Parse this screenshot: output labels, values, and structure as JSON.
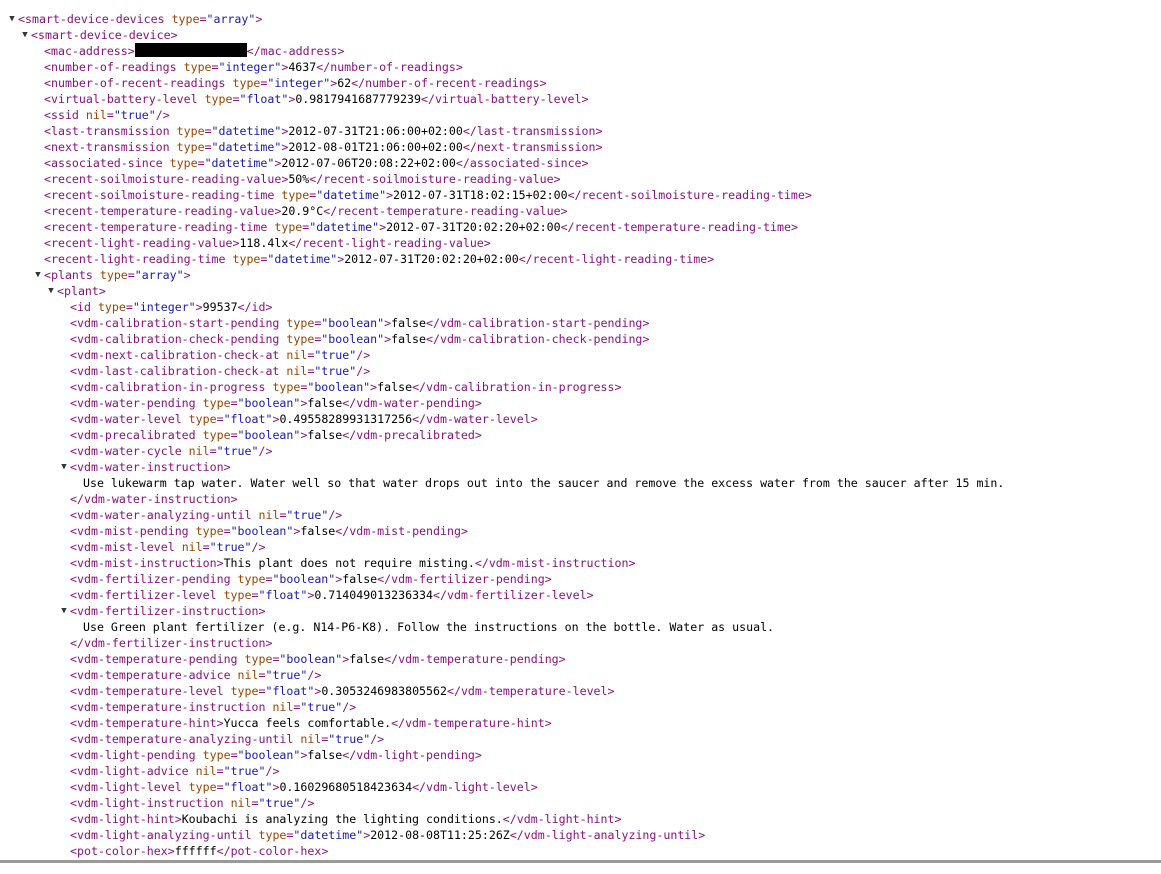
{
  "theme": {
    "tag": "#881280",
    "attr_name": "#994500",
    "attr_value": "#1a1aa6",
    "text": "#000000"
  },
  "lines": [
    {
      "d": 0,
      "t": "open",
      "tw": true,
      "tag": "smart-device-devices",
      "attrs": [
        {
          "n": "type",
          "v": "\"array\""
        }
      ]
    },
    {
      "d": 1,
      "t": "open",
      "tw": true,
      "tag": "smart-device-device",
      "attrs": []
    },
    {
      "d": 2,
      "t": "elem",
      "tag": "mac-address",
      "attrs": [],
      "text": "",
      "redacted": true
    },
    {
      "d": 2,
      "t": "elem",
      "tag": "number-of-readings",
      "attrs": [
        {
          "n": "type",
          "v": "\"integer\""
        }
      ],
      "text": "4637"
    },
    {
      "d": 2,
      "t": "elem",
      "tag": "number-of-recent-readings",
      "attrs": [
        {
          "n": "type",
          "v": "\"integer\""
        }
      ],
      "text": "62"
    },
    {
      "d": 2,
      "t": "elem",
      "tag": "virtual-battery-level",
      "attrs": [
        {
          "n": "type",
          "v": "\"float\""
        }
      ],
      "text": "0.9817941687779239"
    },
    {
      "d": 2,
      "t": "self",
      "tag": "ssid",
      "attrs": [
        {
          "n": "nil",
          "v": "\"true\""
        }
      ]
    },
    {
      "d": 2,
      "t": "elem",
      "tag": "last-transmission",
      "attrs": [
        {
          "n": "type",
          "v": "\"datetime\""
        }
      ],
      "text": "2012-07-31T21:06:00+02:00"
    },
    {
      "d": 2,
      "t": "elem",
      "tag": "next-transmission",
      "attrs": [
        {
          "n": "type",
          "v": "\"datetime\""
        }
      ],
      "text": "2012-08-01T21:06:00+02:00"
    },
    {
      "d": 2,
      "t": "elem",
      "tag": "associated-since",
      "attrs": [
        {
          "n": "type",
          "v": "\"datetime\""
        }
      ],
      "text": "2012-07-06T20:08:22+02:00"
    },
    {
      "d": 2,
      "t": "elem",
      "tag": "recent-soilmoisture-reading-value",
      "attrs": [],
      "text": "50%"
    },
    {
      "d": 2,
      "t": "elem",
      "tag": "recent-soilmoisture-reading-time",
      "attrs": [
        {
          "n": "type",
          "v": "\"datetime\""
        }
      ],
      "text": "2012-07-31T18:02:15+02:00"
    },
    {
      "d": 2,
      "t": "elem",
      "tag": "recent-temperature-reading-value",
      "attrs": [],
      "text": "20.9°C"
    },
    {
      "d": 2,
      "t": "elem",
      "tag": "recent-temperature-reading-time",
      "attrs": [
        {
          "n": "type",
          "v": "\"datetime\""
        }
      ],
      "text": "2012-07-31T20:02:20+02:00"
    },
    {
      "d": 2,
      "t": "elem",
      "tag": "recent-light-reading-value",
      "attrs": [],
      "text": "118.4lx"
    },
    {
      "d": 2,
      "t": "elem",
      "tag": "recent-light-reading-time",
      "attrs": [
        {
          "n": "type",
          "v": "\"datetime\""
        }
      ],
      "text": "2012-07-31T20:02:20+02:00"
    },
    {
      "d": 2,
      "t": "open",
      "tw": true,
      "tag": "plants",
      "attrs": [
        {
          "n": "type",
          "v": "\"array\""
        }
      ]
    },
    {
      "d": 3,
      "t": "open",
      "tw": true,
      "tag": "plant",
      "attrs": []
    },
    {
      "d": 4,
      "t": "elem",
      "tag": "id",
      "attrs": [
        {
          "n": "type",
          "v": "\"integer\""
        }
      ],
      "text": "99537"
    },
    {
      "d": 4,
      "t": "elem",
      "tag": "vdm-calibration-start-pending",
      "attrs": [
        {
          "n": "type",
          "v": "\"boolean\""
        }
      ],
      "text": "false"
    },
    {
      "d": 4,
      "t": "elem",
      "tag": "vdm-calibration-check-pending",
      "attrs": [
        {
          "n": "type",
          "v": "\"boolean\""
        }
      ],
      "text": "false"
    },
    {
      "d": 4,
      "t": "self",
      "tag": "vdm-next-calibration-check-at",
      "attrs": [
        {
          "n": "nil",
          "v": "\"true\""
        }
      ]
    },
    {
      "d": 4,
      "t": "self",
      "tag": "vdm-last-calibration-check-at",
      "attrs": [
        {
          "n": "nil",
          "v": "\"true\""
        }
      ]
    },
    {
      "d": 4,
      "t": "elem",
      "tag": "vdm-calibration-in-progress",
      "attrs": [
        {
          "n": "type",
          "v": "\"boolean\""
        }
      ],
      "text": "false"
    },
    {
      "d": 4,
      "t": "elem",
      "tag": "vdm-water-pending",
      "attrs": [
        {
          "n": "type",
          "v": "\"boolean\""
        }
      ],
      "text": "false"
    },
    {
      "d": 4,
      "t": "elem",
      "tag": "vdm-water-level",
      "attrs": [
        {
          "n": "type",
          "v": "\"float\""
        }
      ],
      "text": "0.49558289931317256"
    },
    {
      "d": 4,
      "t": "elem",
      "tag": "vdm-precalibrated",
      "attrs": [
        {
          "n": "type",
          "v": "\"boolean\""
        }
      ],
      "text": "false"
    },
    {
      "d": 4,
      "t": "self",
      "tag": "vdm-water-cycle",
      "attrs": [
        {
          "n": "nil",
          "v": "\"true\""
        }
      ]
    },
    {
      "d": 4,
      "t": "open",
      "tw": true,
      "tag": "vdm-water-instruction",
      "attrs": []
    },
    {
      "d": 5,
      "t": "text",
      "text": "Use lukewarm tap water. Water well so that water drops out into the saucer and remove the excess water from the saucer after 15 min."
    },
    {
      "d": 4,
      "t": "close",
      "tag": "vdm-water-instruction"
    },
    {
      "d": 4,
      "t": "self",
      "tag": "vdm-water-analyzing-until",
      "attrs": [
        {
          "n": "nil",
          "v": "\"true\""
        }
      ]
    },
    {
      "d": 4,
      "t": "elem",
      "tag": "vdm-mist-pending",
      "attrs": [
        {
          "n": "type",
          "v": "\"boolean\""
        }
      ],
      "text": "false"
    },
    {
      "d": 4,
      "t": "self",
      "tag": "vdm-mist-level",
      "attrs": [
        {
          "n": "nil",
          "v": "\"true\""
        }
      ]
    },
    {
      "d": 4,
      "t": "elem",
      "tag": "vdm-mist-instruction",
      "attrs": [],
      "text": "This plant does not require misting."
    },
    {
      "d": 4,
      "t": "elem",
      "tag": "vdm-fertilizer-pending",
      "attrs": [
        {
          "n": "type",
          "v": "\"boolean\""
        }
      ],
      "text": "false"
    },
    {
      "d": 4,
      "t": "elem",
      "tag": "vdm-fertilizer-level",
      "attrs": [
        {
          "n": "type",
          "v": "\"float\""
        }
      ],
      "text": "0.714049013236334"
    },
    {
      "d": 4,
      "t": "open",
      "tw": true,
      "tag": "vdm-fertilizer-instruction",
      "attrs": []
    },
    {
      "d": 5,
      "t": "text",
      "text": "Use Green plant fertilizer (e.g. N14-P6-K8). Follow the instructions on the bottle. Water as usual."
    },
    {
      "d": 4,
      "t": "close",
      "tag": "vdm-fertilizer-instruction"
    },
    {
      "d": 4,
      "t": "elem",
      "tag": "vdm-temperature-pending",
      "attrs": [
        {
          "n": "type",
          "v": "\"boolean\""
        }
      ],
      "text": "false"
    },
    {
      "d": 4,
      "t": "self",
      "tag": "vdm-temperature-advice",
      "attrs": [
        {
          "n": "nil",
          "v": "\"true\""
        }
      ]
    },
    {
      "d": 4,
      "t": "elem",
      "tag": "vdm-temperature-level",
      "attrs": [
        {
          "n": "type",
          "v": "\"float\""
        }
      ],
      "text": "0.3053246983805562"
    },
    {
      "d": 4,
      "t": "self",
      "tag": "vdm-temperature-instruction",
      "attrs": [
        {
          "n": "nil",
          "v": "\"true\""
        }
      ]
    },
    {
      "d": 4,
      "t": "elem",
      "tag": "vdm-temperature-hint",
      "attrs": [],
      "text": "Yucca feels comfortable."
    },
    {
      "d": 4,
      "t": "self",
      "tag": "vdm-temperature-analyzing-until",
      "attrs": [
        {
          "n": "nil",
          "v": "\"true\""
        }
      ]
    },
    {
      "d": 4,
      "t": "elem",
      "tag": "vdm-light-pending",
      "attrs": [
        {
          "n": "type",
          "v": "\"boolean\""
        }
      ],
      "text": "false"
    },
    {
      "d": 4,
      "t": "self",
      "tag": "vdm-light-advice",
      "attrs": [
        {
          "n": "nil",
          "v": "\"true\""
        }
      ]
    },
    {
      "d": 4,
      "t": "elem",
      "tag": "vdm-light-level",
      "attrs": [
        {
          "n": "type",
          "v": "\"float\""
        }
      ],
      "text": "0.16029680518423634"
    },
    {
      "d": 4,
      "t": "self",
      "tag": "vdm-light-instruction",
      "attrs": [
        {
          "n": "nil",
          "v": "\"true\""
        }
      ]
    },
    {
      "d": 4,
      "t": "elem",
      "tag": "vdm-light-hint",
      "attrs": [],
      "text": "Koubachi is analyzing the lighting conditions."
    },
    {
      "d": 4,
      "t": "elem",
      "tag": "vdm-light-analyzing-until",
      "attrs": [
        {
          "n": "type",
          "v": "\"datetime\""
        }
      ],
      "text": "2012-08-08T11:25:26Z"
    },
    {
      "d": 4,
      "t": "elem",
      "tag": "pot-color-hex",
      "attrs": [],
      "text": "ffffff"
    }
  ]
}
